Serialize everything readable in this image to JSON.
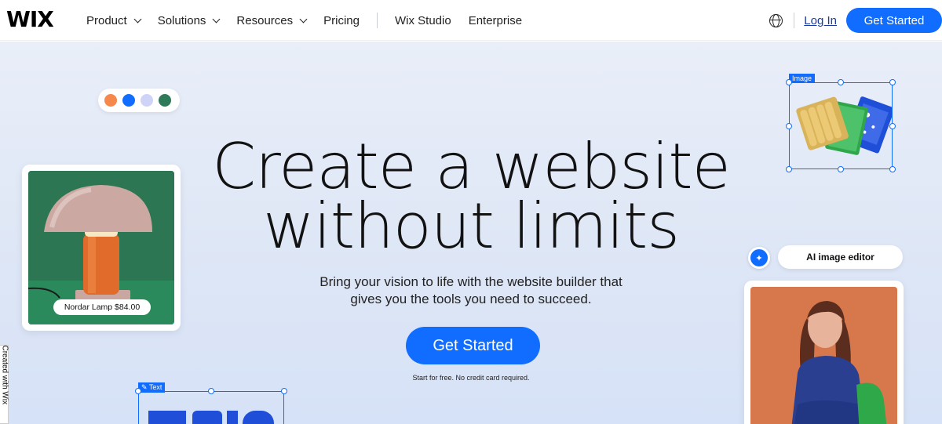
{
  "logo": "WIX",
  "nav": {
    "items": [
      {
        "label": "Product",
        "dropdown": true
      },
      {
        "label": "Solutions",
        "dropdown": true
      },
      {
        "label": "Resources",
        "dropdown": true
      },
      {
        "label": "Pricing",
        "dropdown": false
      }
    ],
    "secondary": [
      "Wix Studio",
      "Enterprise"
    ],
    "login": "Log In",
    "cta": "Get Started"
  },
  "hero": {
    "headline_line1": "Create a website",
    "headline_line2": "without limits",
    "subtext_line1": "Bring your vision to life with the website builder that",
    "subtext_line2": "gives you the tools you need to succeed.",
    "cta": "Get Started",
    "note": "Start for free. No credit card required."
  },
  "color_dots": [
    "#f5884a",
    "#116dff",
    "#cfd3f7",
    "#2f7a58"
  ],
  "lamp_card": {
    "price_tag": "Nordar Lamp $84.00"
  },
  "image_widget": {
    "label": "Image"
  },
  "text_widget": {
    "label": "Text"
  },
  "ai_editor": {
    "label": "AI image editor"
  },
  "badge": {
    "text": "Created with Wix"
  }
}
